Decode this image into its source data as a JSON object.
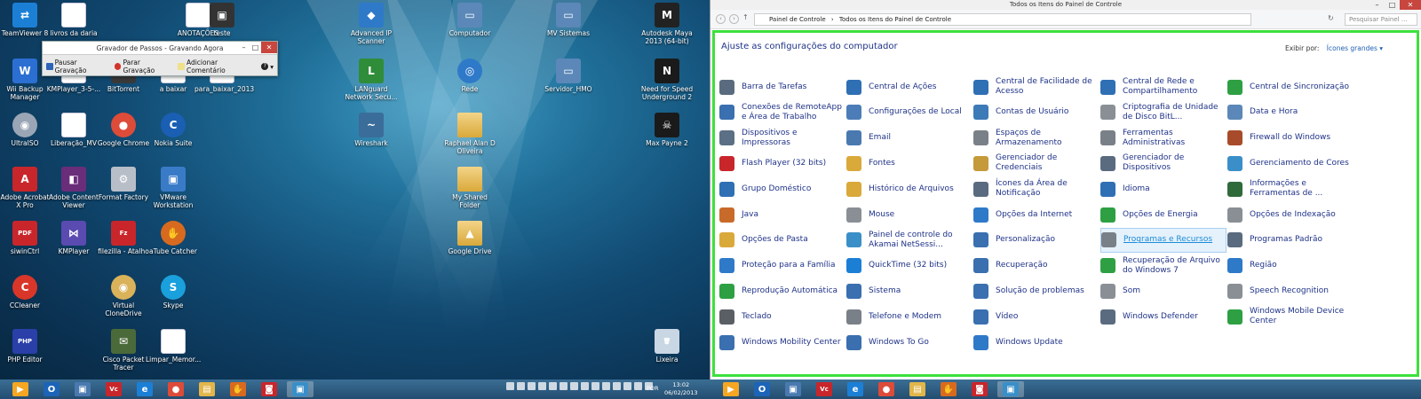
{
  "desktop": {
    "icons": [
      {
        "label": "TeamViewer 8",
        "icon": "teamviewer-icon",
        "color": "#1c7fd6",
        "glyph": "⇄",
        "kind": ""
      },
      {
        "label": "livros da daria",
        "icon": "document-icon",
        "color": "#ffffff",
        "glyph": "",
        "kind": "doc"
      },
      {
        "label": "ANOTAÇÕES",
        "icon": "document-icon",
        "color": "#ffffff",
        "glyph": "",
        "kind": "doc"
      },
      {
        "label": "teste",
        "icon": "media-file-icon",
        "color": "#333333",
        "glyph": "▣",
        "kind": ""
      },
      {
        "label": "Advanced IP Scanner",
        "icon": "network-scanner-icon",
        "color": "#2f79c9",
        "glyph": "◆",
        "kind": ""
      },
      {
        "label": "Computador",
        "icon": "computer-icon",
        "color": "#5b88b8",
        "glyph": "▭",
        "kind": ""
      },
      {
        "label": "MV Sistemas",
        "icon": "network-computer-icon",
        "color": "#5b88b8",
        "glyph": "▭",
        "kind": ""
      },
      {
        "label": "Autodesk Maya 2013 (64-bit)",
        "icon": "maya-icon",
        "color": "#222222",
        "glyph": "M",
        "kind": ""
      },
      {
        "label": "Wii Backup Manager",
        "icon": "wii-backup-icon",
        "color": "#2a6fd1",
        "glyph": "W",
        "kind": ""
      },
      {
        "label": "KMPlayer_3-5-...",
        "icon": "document-icon",
        "color": "#ffffff",
        "glyph": "",
        "kind": "doc"
      },
      {
        "label": "BitTorrent",
        "icon": "bittorrent-icon",
        "color": "#3a3a3a",
        "glyph": "B",
        "kind": ""
      },
      {
        "label": "a baixar",
        "icon": "document-icon",
        "color": "#ffffff",
        "glyph": "",
        "kind": "doc"
      },
      {
        "label": "para_baixar_2013",
        "icon": "document-icon",
        "color": "#ffffff",
        "glyph": "",
        "kind": "doc"
      },
      {
        "label": "LANguard Network Secu...",
        "icon": "languard-icon",
        "color": "#2f8d3a",
        "glyph": "L",
        "kind": ""
      },
      {
        "label": "Rede",
        "icon": "network-globe-icon",
        "color": "#2f79c9",
        "glyph": "◎",
        "kind": "round"
      },
      {
        "label": "Servidor_HMO",
        "icon": "network-computer-icon",
        "color": "#5b88b8",
        "glyph": "▭",
        "kind": ""
      },
      {
        "label": "Need for Speed Underground 2",
        "icon": "game-icon",
        "color": "#1a1a1a",
        "glyph": "N",
        "kind": ""
      },
      {
        "label": "UltraISO",
        "icon": "disc-icon",
        "color": "#9aa6b5",
        "glyph": "◉",
        "kind": "round"
      },
      {
        "label": "Liberação_MV",
        "icon": "document-icon",
        "color": "#ffffff",
        "glyph": "",
        "kind": "doc"
      },
      {
        "label": "Google Chrome",
        "icon": "chrome-icon",
        "color": "#dd4b39",
        "glyph": "●",
        "kind": "round"
      },
      {
        "label": "Nokia Suite",
        "icon": "nokia-suite-icon",
        "color": "#1a5fb4",
        "glyph": "C",
        "kind": "round"
      },
      {
        "label": "Wireshark",
        "icon": "wireshark-icon",
        "color": "#3a6d9a",
        "glyph": "~",
        "kind": ""
      },
      {
        "label": "Raphael Alan D Oliveira",
        "icon": "user-folder-icon",
        "color": "#e2b64a",
        "glyph": "",
        "kind": "fold"
      },
      {
        "label": "Max Payne 2",
        "icon": "game-icon",
        "color": "#1a1a1a",
        "glyph": "☠",
        "kind": ""
      },
      {
        "label": "Adobe Acrobat X Pro",
        "icon": "acrobat-icon",
        "color": "#c8262b",
        "glyph": "A",
        "kind": ""
      },
      {
        "label": "Adobe Content Viewer",
        "icon": "content-viewer-icon",
        "color": "#6a2d7a",
        "glyph": "◧",
        "kind": ""
      },
      {
        "label": "Format Factory",
        "icon": "format-factory-icon",
        "color": "#b8bec8",
        "glyph": "⚙",
        "kind": ""
      },
      {
        "label": "VMware Workstation",
        "icon": "vmware-icon",
        "color": "#3a7bc8",
        "glyph": "▣",
        "kind": ""
      },
      {
        "label": "My Shared Folder",
        "icon": "folder-icon",
        "color": "#e2b64a",
        "glyph": "",
        "kind": "fold"
      },
      {
        "label": "siwinCtrl",
        "icon": "pdf-file-icon",
        "color": "#c8262b",
        "glyph": "PDF",
        "kind": ""
      },
      {
        "label": "KMPlayer",
        "icon": "kmplayer-icon",
        "color": "#5a4bb0",
        "glyph": "⋈",
        "kind": ""
      },
      {
        "label": "filezilla - Atalho",
        "icon": "filezilla-icon",
        "color": "#c8262b",
        "glyph": "Fz",
        "kind": ""
      },
      {
        "label": "aTube Catcher",
        "icon": "atube-catcher-icon",
        "color": "#d86a1f",
        "glyph": "✋",
        "kind": "round"
      },
      {
        "label": "Google Drive",
        "icon": "google-drive-folder-icon",
        "color": "#e2b64a",
        "glyph": "▲",
        "kind": "fold"
      },
      {
        "label": "CCleaner",
        "icon": "ccleaner-icon",
        "color": "#d9362a",
        "glyph": "C",
        "kind": "round"
      },
      {
        "label": "Virtual CloneDrive",
        "icon": "clonedrive-icon",
        "color": "#d9b25a",
        "glyph": "◉",
        "kind": "round"
      },
      {
        "label": "Skype",
        "icon": "skype-icon",
        "color": "#1aa0dc",
        "glyph": "S",
        "kind": "round"
      },
      {
        "label": "PHP Editor",
        "icon": "php-icon",
        "color": "#2a3fa8",
        "glyph": "PHP",
        "kind": ""
      },
      {
        "label": "Cisco Packet Tracer",
        "icon": "cisco-icon",
        "color": "#4b6a3a",
        "glyph": "✉",
        "kind": ""
      },
      {
        "label": "Limpar_Memor...",
        "icon": "document-icon",
        "color": "#ffffff",
        "glyph": "",
        "kind": "doc"
      },
      {
        "label": "Lixeira",
        "icon": "recycle-bin-icon",
        "color": "#c9d6e3",
        "glyph": "🗑",
        "kind": ""
      }
    ]
  },
  "recorder": {
    "title": "Gravador de Passos - Gravando Agora",
    "pause_label": "Pausar Gravação",
    "stop_label": "Parar Gravação",
    "comment_label": "Adicionar Comentário",
    "help_glyph": "?",
    "dropdown_glyph": "▾"
  },
  "control_panel": {
    "window_title": "Todos os Itens do Painel de Controle",
    "breadcrumb": [
      "Painel de Controle",
      "Todos os Itens do Painel de Controle"
    ],
    "breadcrumb_sep": "›",
    "search_placeholder": "Pesquisar Painel ...",
    "heading": "Ajuste as configurações do computador",
    "view_by_label": "Exibir por:",
    "view_by_value": "Ícones grandes ▾",
    "highlighted": "Programas e Recursos",
    "items": [
      {
        "label": "Barra de Tarefas",
        "icon": "taskbar-icon",
        "color": "#5a6b80"
      },
      {
        "label": "Central de Ações",
        "icon": "action-center-flag-icon",
        "color": "#2f6fb4"
      },
      {
        "label": "Central de Facilidade de Acesso",
        "icon": "ease-of-access-icon",
        "color": "#2f6fb4"
      },
      {
        "label": "Central de Rede e Compartilhamento",
        "icon": "network-center-icon",
        "color": "#2f6fb4"
      },
      {
        "label": "Central de Sincronização",
        "icon": "sync-center-icon",
        "color": "#2ea043"
      },
      {
        "label": "Conexões de RemoteApp e Área de Trabalho",
        "icon": "remoteapp-icon",
        "color": "#3a6fb0"
      },
      {
        "label": "Configurações de Local",
        "icon": "location-settings-icon",
        "color": "#4c7db8"
      },
      {
        "label": "Contas de Usuário",
        "icon": "user-accounts-icon",
        "color": "#3d7ab8"
      },
      {
        "label": "Criptografia de Unidade de Disco BitL...",
        "icon": "bitlocker-icon",
        "color": "#8a8f96"
      },
      {
        "label": "Data e Hora",
        "icon": "date-time-icon",
        "color": "#5b88b8"
      },
      {
        "label": "Dispositivos e Impressoras",
        "icon": "devices-printers-icon",
        "color": "#5b6f85"
      },
      {
        "label": "Email",
        "icon": "email-icon",
        "color": "#4a79b0"
      },
      {
        "label": "Espaços de Armazenamento",
        "icon": "storage-spaces-icon",
        "color": "#7a8088"
      },
      {
        "label": "Ferramentas Administrativas",
        "icon": "admin-tools-icon",
        "color": "#7a8088"
      },
      {
        "label": "Firewall do Windows",
        "icon": "firewall-icon",
        "color": "#a84b2a"
      },
      {
        "label": "Flash Player (32 bits)",
        "icon": "flash-player-icon",
        "color": "#c8262b"
      },
      {
        "label": "Fontes",
        "icon": "fonts-icon",
        "color": "#d9a93a"
      },
      {
        "label": "Gerenciador de Credenciais",
        "icon": "credential-manager-icon",
        "color": "#c49a3a"
      },
      {
        "label": "Gerenciador de Dispositivos",
        "icon": "device-manager-icon",
        "color": "#5a6b80"
      },
      {
        "label": "Gerenciamento de Cores",
        "icon": "color-management-icon",
        "color": "#3a8fc8"
      },
      {
        "label": "Grupo Doméstico",
        "icon": "homegroup-icon",
        "color": "#2f6fb4"
      },
      {
        "label": "Histórico de Arquivos",
        "icon": "file-history-icon",
        "color": "#d9a93a"
      },
      {
        "label": "Ícones da Área de Notificação",
        "icon": "notification-icons-icon",
        "color": "#5a6b80"
      },
      {
        "label": "Idioma",
        "icon": "language-icon",
        "color": "#2f6fb4"
      },
      {
        "label": "Informações e Ferramentas de ...",
        "icon": "performance-info-icon",
        "color": "#2f6a3a"
      },
      {
        "label": "Java",
        "icon": "java-icon",
        "color": "#c86a2a"
      },
      {
        "label": "Mouse",
        "icon": "mouse-icon",
        "color": "#8a8f96"
      },
      {
        "label": "Opções da Internet",
        "icon": "internet-options-icon",
        "color": "#2f79c9"
      },
      {
        "label": "Opções de Energia",
        "icon": "power-options-icon",
        "color": "#2ea043"
      },
      {
        "label": "Opções de Indexação",
        "icon": "indexing-icon",
        "color": "#8a8f96"
      },
      {
        "label": "Opções de Pasta",
        "icon": "folder-options-icon",
        "color": "#d9a93a"
      },
      {
        "label": "Painel de controle do Akamai NetSessi...",
        "icon": "akamai-icon",
        "color": "#3a8fc8"
      },
      {
        "label": "Personalização",
        "icon": "personalization-icon",
        "color": "#3a6fb0"
      },
      {
        "label": "Programas e Recursos",
        "icon": "programs-features-icon",
        "color": "#7a8088"
      },
      {
        "label": "Programas Padrão",
        "icon": "default-programs-icon",
        "color": "#5a6b80"
      },
      {
        "label": "Proteção para a Família",
        "icon": "family-safety-icon",
        "color": "#2f79c9"
      },
      {
        "label": "QuickTime (32 bits)",
        "icon": "quicktime-icon",
        "color": "#1c7fd6"
      },
      {
        "label": "Recuperação",
        "icon": "recovery-icon",
        "color": "#3a6fb0"
      },
      {
        "label": "Recuperação de Arquivo do Windows 7",
        "icon": "windows7-recovery-icon",
        "color": "#2ea043"
      },
      {
        "label": "Região",
        "icon": "region-icon",
        "color": "#2f79c9"
      },
      {
        "label": "Reprodução Automática",
        "icon": "autoplay-icon",
        "color": "#2ea043"
      },
      {
        "label": "Sistema",
        "icon": "system-icon",
        "color": "#3a6fb0"
      },
      {
        "label": "Solução de problemas",
        "icon": "troubleshooting-icon",
        "color": "#3a6fb0"
      },
      {
        "label": "Som",
        "icon": "sound-icon",
        "color": "#8a8f96"
      },
      {
        "label": "Speech Recognition",
        "icon": "microphone-icon",
        "color": "#8a8f96"
      },
      {
        "label": "Teclado",
        "icon": "keyboard-icon",
        "color": "#5a5f66"
      },
      {
        "label": "Telefone e Modem",
        "icon": "phone-modem-icon",
        "color": "#7a8088"
      },
      {
        "label": "Vídeo",
        "icon": "display-icon",
        "color": "#3a6fb0"
      },
      {
        "label": "Windows Defender",
        "icon": "windows-defender-icon",
        "color": "#5a6b80"
      },
      {
        "label": "Windows Mobile Device Center",
        "icon": "mobile-device-center-icon",
        "color": "#2ea043"
      },
      {
        "label": "Windows Mobility Center",
        "icon": "mobility-center-icon",
        "color": "#3a6fb0"
      },
      {
        "label": "Windows To Go",
        "icon": "windows-to-go-icon",
        "color": "#3a6fb0"
      },
      {
        "label": "Windows Update",
        "icon": "windows-update-icon",
        "color": "#2f79c9"
      }
    ]
  },
  "taskbar": {
    "left_apps": [
      {
        "name": "start-icon",
        "glyph": "▶",
        "color": "#f5a623"
      },
      {
        "name": "outlook-icon",
        "glyph": "O",
        "color": "#1c64b8"
      },
      {
        "name": "remote-desktop-icon",
        "glyph": "▣",
        "color": "#4a79b0"
      },
      {
        "name": "vc-app-icon",
        "glyph": "Vc",
        "color": "#c8262b"
      },
      {
        "name": "internet-explorer-icon",
        "glyph": "e",
        "color": "#1c7fd6"
      },
      {
        "name": "chrome-icon",
        "glyph": "●",
        "color": "#dd4b39"
      },
      {
        "name": "file-explorer-icon",
        "glyph": "▤",
        "color": "#e2b64a"
      },
      {
        "name": "atube-catcher-icon",
        "glyph": "✋",
        "color": "#d86a1f"
      },
      {
        "name": "steps-recorder-icon",
        "glyph": "◙",
        "color": "#c8262b"
      },
      {
        "name": "control-panel-icon",
        "glyph": "▣",
        "color": "#3a8fc8",
        "active": true
      }
    ],
    "right_apps": [
      {
        "name": "start-icon",
        "glyph": "▶",
        "color": "#f5a623"
      },
      {
        "name": "outlook-icon",
        "glyph": "O",
        "color": "#1c64b8"
      },
      {
        "name": "remote-desktop-icon",
        "glyph": "▣",
        "color": "#4a79b0"
      },
      {
        "name": "vc-app-icon",
        "glyph": "Vc",
        "color": "#c8262b"
      },
      {
        "name": "internet-explorer-icon",
        "glyph": "e",
        "color": "#1c7fd6"
      },
      {
        "name": "chrome-icon",
        "glyph": "●",
        "color": "#dd4b39"
      },
      {
        "name": "file-explorer-icon",
        "glyph": "▤",
        "color": "#e2b64a"
      },
      {
        "name": "atube-catcher-icon",
        "glyph": "✋",
        "color": "#d86a1f"
      },
      {
        "name": "steps-recorder-icon",
        "glyph": "◙",
        "color": "#c8262b"
      },
      {
        "name": "control-panel-icon",
        "glyph": "▣",
        "color": "#3a8fc8",
        "active": true
      }
    ],
    "language": "POR",
    "time": "13:02",
    "date": "06/02/2013"
  }
}
